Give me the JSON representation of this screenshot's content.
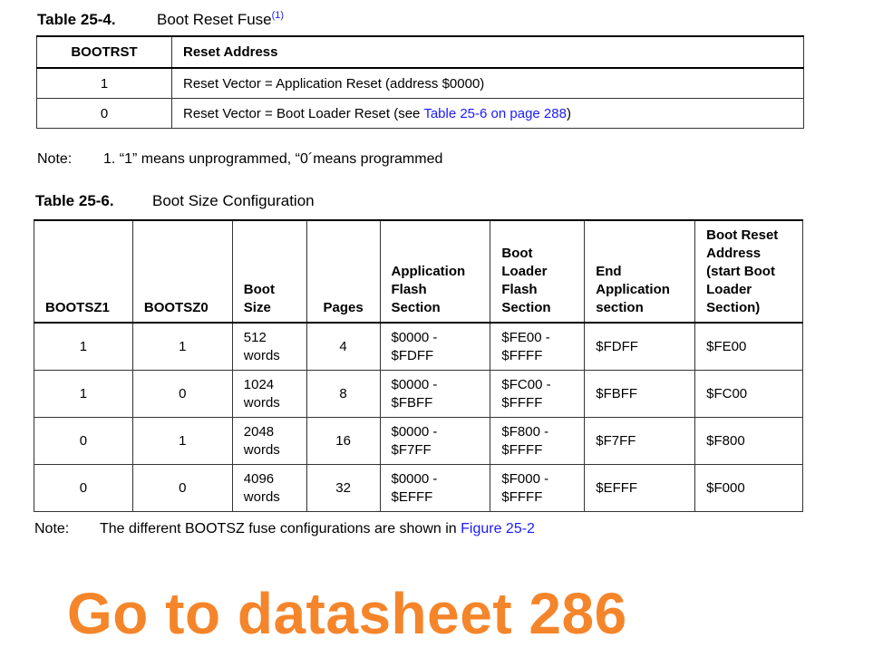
{
  "table1": {
    "number": "Table 25-4.",
    "title": "Boot Reset Fuse",
    "footnote_ref": "(1)",
    "headers": [
      "BOOTRST",
      "Reset Address"
    ],
    "rows": [
      {
        "value": "1",
        "text": "Reset Vector = Application Reset (address $0000)"
      },
      {
        "value": "0",
        "text_before": "Reset Vector = Boot Loader Reset (see ",
        "link": "Table 25-6 on page 288",
        "text_after": ")"
      }
    ],
    "note_label": "Note:",
    "note_text": "1.  “1” means unprogrammed, “0´means programmed"
  },
  "table2": {
    "number": "Table 25-6.",
    "title": "Boot Size Configuration",
    "headers": {
      "bootsz1": "BOOTSZ1",
      "bootsz0": "BOOTSZ0",
      "boot_size": [
        "Boot",
        "Size"
      ],
      "pages": "Pages",
      "app_flash": [
        "Application",
        "Flash",
        "Section"
      ],
      "boot_flash": [
        "Boot",
        "Loader",
        "Flash",
        "Section"
      ],
      "end_app": [
        "End",
        "Application",
        "section"
      ],
      "boot_reset": [
        "Boot Reset",
        "Address",
        "(start Boot",
        "Loader",
        "Section)"
      ]
    },
    "rows": [
      {
        "bootsz1": "1",
        "bootsz0": "1",
        "size": [
          "512",
          "words"
        ],
        "pages": "4",
        "app": [
          "$0000 -",
          "$FDFF"
        ],
        "boot": [
          "$FE00 -",
          "$FFFF"
        ],
        "end": "$FDFF",
        "reset": "$FE00"
      },
      {
        "bootsz1": "1",
        "bootsz0": "0",
        "size": [
          "1024",
          "words"
        ],
        "pages": "8",
        "app": [
          "$0000 -",
          "$FBFF"
        ],
        "boot": [
          "$FC00 -",
          "$FFFF"
        ],
        "end": "$FBFF",
        "reset": "$FC00"
      },
      {
        "bootsz1": "0",
        "bootsz0": "1",
        "size": [
          "2048",
          "words"
        ],
        "pages": "16",
        "app": [
          "$0000 -",
          "$F7FF"
        ],
        "boot": [
          "$F800 -",
          "$FFFF"
        ],
        "end": "$F7FF",
        "reset": "$F800"
      },
      {
        "bootsz1": "0",
        "bootsz0": "0",
        "size": [
          "4096",
          "words"
        ],
        "pages": "32",
        "app": [
          "$0000 -",
          "$EFFF"
        ],
        "boot": [
          "$F000 -",
          "$FFFF"
        ],
        "end": "$EFFF",
        "reset": "$F000"
      }
    ],
    "note_label": "Note:",
    "note_text": "The different BOOTSZ fuse configurations are shown in ",
    "note_link": "Figure 25-2"
  },
  "banner": "Go to datasheet 286",
  "colors": {
    "link": "#1a1aff",
    "banner": "#f5852a"
  }
}
